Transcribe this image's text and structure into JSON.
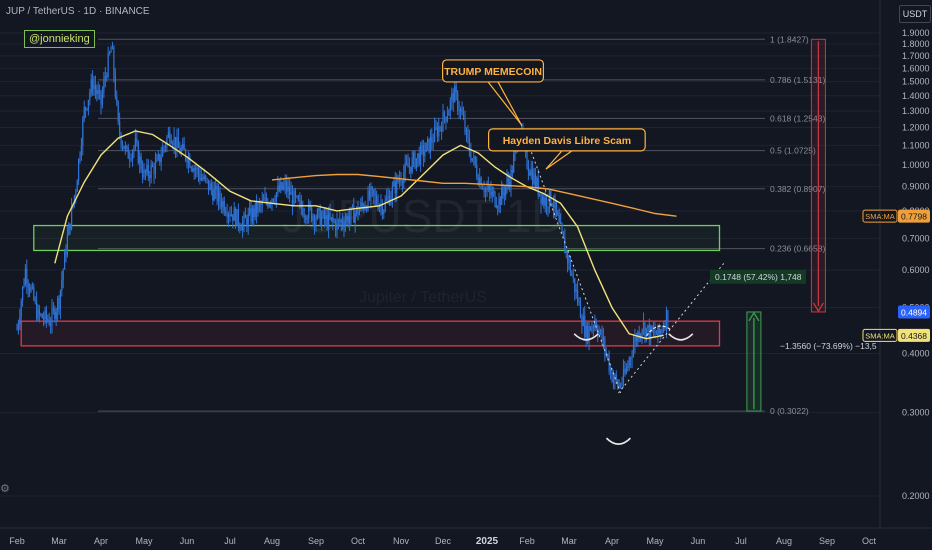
{
  "header": {
    "title": "JUP / TetherUS · 1D · BINANCE",
    "currency": "USDT"
  },
  "watermark": {
    "main": "JUPUSDT 1D",
    "sub": "Jupiter / TetherUS"
  },
  "author_handle": "@jonnieking",
  "icons": {
    "settings": "gear-icon"
  },
  "colors": {
    "background": "#131722",
    "candle": "#2f73d6",
    "sma_fast": "#f1e27a",
    "sma_slow": "#f0a03a",
    "support_zone": "#6ccf5a",
    "resistance_zone": "#e03a48",
    "fib_line": "#505460",
    "callout": "#ffb23f",
    "measure_down": "#c23a45",
    "measure_up": "#3fa050",
    "price_badge": "#2962ff"
  },
  "chart_data": {
    "type": "candlestick",
    "symbol": "JUP / TetherUS",
    "interval": "1D",
    "exchange": "BINANCE",
    "y_axis": {
      "scale": "log",
      "range": [
        0.19,
        1.92
      ],
      "ticks": [
        "1.9000",
        "1.8000",
        "1.7000",
        "1.6000",
        "1.5000",
        "1.4000",
        "1.3000",
        "1.2000",
        "1.1000",
        "1.0000",
        "0.9000",
        "0.8000",
        "0.7000",
        "0.6000",
        "0.5000",
        "0.4000",
        "0.3000",
        "0.2000"
      ]
    },
    "x_axis": {
      "labels": [
        "Feb",
        "Mar",
        "Apr",
        "May",
        "Jun",
        "Jul",
        "Aug",
        "Sep",
        "Oct",
        "Nov",
        "Dec",
        "2025",
        "Feb",
        "Mar",
        "Apr",
        "May",
        "Jun",
        "Jul",
        "Aug",
        "Sep",
        "Oct"
      ],
      "bold_label": "2025",
      "month_range": [
        0,
        20
      ]
    },
    "price_path": [
      [
        0.0,
        0.45
      ],
      [
        0.2,
        0.6
      ],
      [
        0.5,
        0.48
      ],
      [
        0.8,
        0.47
      ],
      [
        1.0,
        0.52
      ],
      [
        1.2,
        0.7
      ],
      [
        1.4,
        0.9
      ],
      [
        1.6,
        1.3
      ],
      [
        1.8,
        1.5
      ],
      [
        2.0,
        1.35
      ],
      [
        2.1,
        1.55
      ],
      [
        2.25,
        1.78
      ],
      [
        2.4,
        1.2
      ],
      [
        2.6,
        1.05
      ],
      [
        2.8,
        1.1
      ],
      [
        3.0,
        0.95
      ],
      [
        3.3,
        1.0
      ],
      [
        3.6,
        1.18
      ],
      [
        3.8,
        1.08
      ],
      [
        4.0,
        1.05
      ],
      [
        4.3,
        0.95
      ],
      [
        4.6,
        0.88
      ],
      [
        5.0,
        0.8
      ],
      [
        5.3,
        0.75
      ],
      [
        5.6,
        0.8
      ],
      [
        6.0,
        0.86
      ],
      [
        6.3,
        0.9
      ],
      [
        6.6,
        0.82
      ],
      [
        7.0,
        0.78
      ],
      [
        7.5,
        0.75
      ],
      [
        8.0,
        0.8
      ],
      [
        8.3,
        0.86
      ],
      [
        8.6,
        0.82
      ],
      [
        9.0,
        0.95
      ],
      [
        9.3,
        1.02
      ],
      [
        9.6,
        1.08
      ],
      [
        9.9,
        1.2
      ],
      [
        10.1,
        1.3
      ],
      [
        10.25,
        1.42
      ],
      [
        10.4,
        1.3
      ],
      [
        10.6,
        1.08
      ],
      [
        10.8,
        0.95
      ],
      [
        11.0,
        0.88
      ],
      [
        11.3,
        0.84
      ],
      [
        11.6,
        0.95
      ],
      [
        11.8,
        1.2
      ],
      [
        12.0,
        1.02
      ],
      [
        12.2,
        0.92
      ],
      [
        12.4,
        0.84
      ],
      [
        12.6,
        0.85
      ],
      [
        12.8,
        0.72
      ],
      [
        13.0,
        0.62
      ],
      [
        13.2,
        0.52
      ],
      [
        13.4,
        0.44
      ],
      [
        13.6,
        0.47
      ],
      [
        13.8,
        0.42
      ],
      [
        14.0,
        0.36
      ],
      [
        14.15,
        0.34
      ],
      [
        14.3,
        0.36
      ],
      [
        14.5,
        0.42
      ],
      [
        14.7,
        0.46
      ],
      [
        14.9,
        0.44
      ],
      [
        15.1,
        0.44
      ],
      [
        15.3,
        0.49
      ]
    ],
    "series": [
      {
        "name": "SMA:MA",
        "color": "#f1e27a",
        "last_value": "0.4368",
        "points": [
          [
            0.9,
            0.62
          ],
          [
            1.2,
            0.78
          ],
          [
            1.6,
            0.92
          ],
          [
            2.0,
            1.05
          ],
          [
            2.4,
            1.14
          ],
          [
            2.8,
            1.18
          ],
          [
            3.2,
            1.16
          ],
          [
            3.6,
            1.1
          ],
          [
            4.0,
            1.04
          ],
          [
            4.5,
            0.96
          ],
          [
            5.0,
            0.88
          ],
          [
            5.5,
            0.84
          ],
          [
            6.0,
            0.83
          ],
          [
            6.5,
            0.82
          ],
          [
            7.0,
            0.82
          ],
          [
            7.5,
            0.8
          ],
          [
            8.0,
            0.81
          ],
          [
            8.5,
            0.82
          ],
          [
            9.0,
            0.86
          ],
          [
            9.5,
            0.95
          ],
          [
            10.0,
            1.05
          ],
          [
            10.4,
            1.1
          ],
          [
            10.8,
            1.06
          ],
          [
            11.2,
            0.99
          ],
          [
            11.6,
            0.94
          ],
          [
            12.0,
            0.9
          ],
          [
            12.4,
            0.87
          ],
          [
            12.8,
            0.83
          ],
          [
            13.2,
            0.74
          ],
          [
            13.6,
            0.6
          ],
          [
            14.0,
            0.5
          ],
          [
            14.4,
            0.44
          ],
          [
            14.8,
            0.43
          ],
          [
            15.2,
            0.4368
          ]
        ]
      },
      {
        "name": "SMA:MA",
        "color": "#f0a03a",
        "last_value": "0.7798",
        "points": [
          [
            6.0,
            0.93
          ],
          [
            6.5,
            0.94
          ],
          [
            7.0,
            0.95
          ],
          [
            7.5,
            0.955
          ],
          [
            8.0,
            0.955
          ],
          [
            8.5,
            0.945
          ],
          [
            9.0,
            0.935
          ],
          [
            9.5,
            0.925
          ],
          [
            10.0,
            0.915
          ],
          [
            10.5,
            0.915
          ],
          [
            11.0,
            0.91
          ],
          [
            11.5,
            0.905
          ],
          [
            12.0,
            0.9
          ],
          [
            12.5,
            0.89
          ],
          [
            13.0,
            0.87
          ],
          [
            13.5,
            0.85
          ],
          [
            14.0,
            0.83
          ],
          [
            14.5,
            0.81
          ],
          [
            15.0,
            0.79
          ],
          [
            15.5,
            0.7798
          ]
        ]
      }
    ],
    "current_price": "0.4894",
    "fib_levels": [
      {
        "label": "1 (1.8427)",
        "value": 1.8427
      },
      {
        "label": "0.786 (1.5131)",
        "value": 1.5131
      },
      {
        "label": "0.618 (1.2543)",
        "value": 1.2543
      },
      {
        "label": "0.5 (1.0725)",
        "value": 1.0725
      },
      {
        "label": "0.382 (0.8907)",
        "value": 0.8907
      },
      {
        "label": "0.236 (0.6658)",
        "value": 0.6658
      },
      {
        "label": "0 (0.3022)",
        "value": 0.3022
      }
    ],
    "zones": [
      {
        "name": "support",
        "top": 0.745,
        "bottom": 0.66,
        "from_month": 0.4,
        "to_month": 16.5
      },
      {
        "name": "resistance",
        "top": 0.468,
        "bottom": 0.415,
        "from_month": 0.1,
        "to_month": 16.5
      }
    ],
    "annotations": [
      {
        "text": "TRUMP MEMECOIN",
        "month": 11.15,
        "price": 1.58,
        "target_month": 11.85,
        "target_price": 1.22
      },
      {
        "text": "Hayden Davis Libre Scam",
        "month": 12.95,
        "price": 1.13,
        "target_month": 12.45,
        "target_price": 0.98
      }
    ],
    "measures": [
      {
        "label": "−1.3560 (−73.69%) −13,5",
        "from_price": 1.8427,
        "to_price": 0.4894,
        "month": 18.8,
        "direction": "down"
      },
      {
        "label": "0.1748 (57.42%) 1,748",
        "from_price": 0.3022,
        "to_price": 0.4894,
        "month": 17.3,
        "direction": "up"
      }
    ]
  }
}
